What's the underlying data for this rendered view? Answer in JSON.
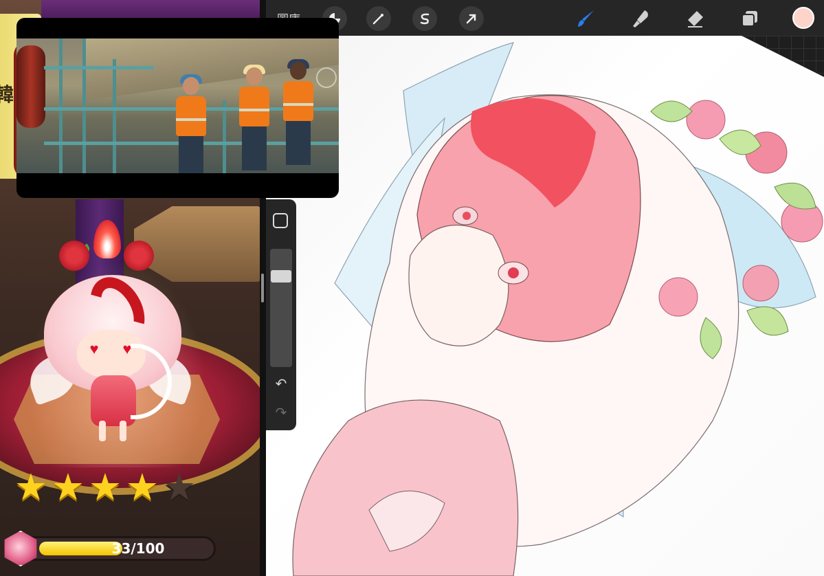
{
  "game": {
    "banner_text": "韓",
    "stars": {
      "filled": 4,
      "total": 5
    },
    "progress": {
      "current": 33,
      "max": 100,
      "label": "33/100"
    },
    "colors": {
      "star": "#ffd21f",
      "bar": "#f2c200",
      "platform": "#c8324a"
    }
  },
  "video": {
    "watermark": "",
    "icons": [
      "hard-hat-icon"
    ]
  },
  "app": {
    "menu_label": "圖庫",
    "tools": [
      {
        "name": "adjustments-icon",
        "active": false
      },
      {
        "name": "selection-magic-icon",
        "active": false
      },
      {
        "name": "transform-s-icon",
        "active": false
      },
      {
        "name": "move-arrow-icon",
        "active": false
      },
      {
        "name": "brush-icon",
        "active": true
      },
      {
        "name": "smudge-icon",
        "active": false
      },
      {
        "name": "eraser-icon",
        "active": false
      },
      {
        "name": "layers-icon",
        "active": false
      }
    ],
    "active_color": "#fdd4ca",
    "accent": "#2a7cf0",
    "sidebar": {
      "modifier_icon": "square-icon",
      "undo_icon": "undo-icon",
      "redo_icon": "redo-icon",
      "brush_size_level": 0.2
    }
  }
}
